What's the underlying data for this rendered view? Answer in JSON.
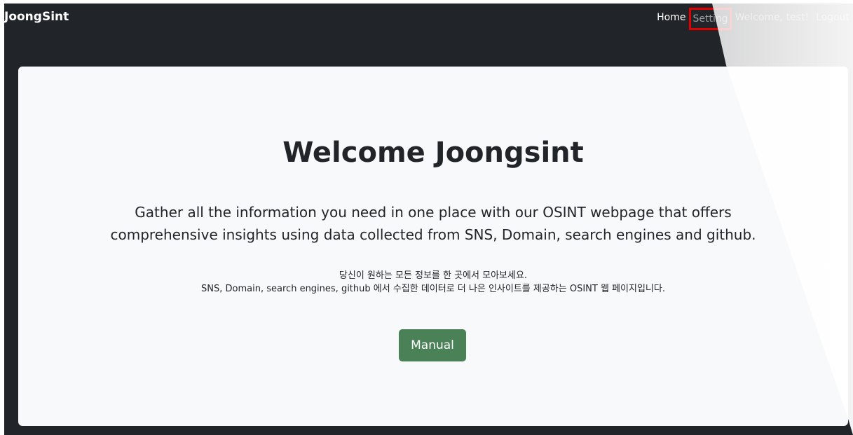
{
  "navbar": {
    "brand": "JoongSint",
    "links": {
      "home": "Home",
      "setting": "Setting",
      "welcome": "Welcome, test!",
      "logout": "Logout"
    }
  },
  "hero": {
    "title": "Welcome Joongsint",
    "lead_line1": "Gather all the information you need in one place with our OSINT webpage that offers",
    "lead_line2": "comprehensive insights using data collected from SNS, Domain, search engines and github.",
    "korean_line1": "당신이 원하는 모든 정보를 한 곳에서 모아보세요.",
    "korean_line2": "SNS, Domain, search engines, github 에서 수집한 데이터로 더 나은 인사이트를 제공하는 OSINT 웹 페이지입니다.",
    "button_label": "Manual"
  },
  "colors": {
    "navbar_bg": "#212529",
    "card_bg": "#f8f9fa",
    "button_bg": "#4a8157",
    "highlight": "#e00000"
  }
}
